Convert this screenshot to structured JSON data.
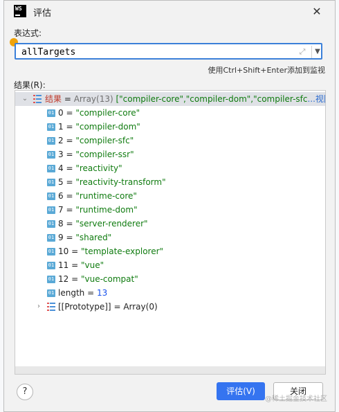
{
  "window": {
    "app_icon_text": "WS",
    "title": "评估"
  },
  "expression": {
    "label": "表达式:",
    "value": "allTargets",
    "hint": "使用Ctrl+Shift+Enter添加到监视"
  },
  "result": {
    "label": "结果(R):",
    "root": {
      "name": "结果",
      "eq": " = ",
      "type": "Array(13)",
      "preview": " [\"compiler-core\",\"compiler-dom\",\"compiler-sfc",
      "link": "...视图"
    },
    "items": [
      {
        "index": "0",
        "value": "\"compiler-core\""
      },
      {
        "index": "1",
        "value": "\"compiler-dom\""
      },
      {
        "index": "2",
        "value": "\"compiler-sfc\""
      },
      {
        "index": "3",
        "value": "\"compiler-ssr\""
      },
      {
        "index": "4",
        "value": "\"reactivity\""
      },
      {
        "index": "5",
        "value": "\"reactivity-transform\""
      },
      {
        "index": "6",
        "value": "\"runtime-core\""
      },
      {
        "index": "7",
        "value": "\"runtime-dom\""
      },
      {
        "index": "8",
        "value": "\"server-renderer\""
      },
      {
        "index": "9",
        "value": "\"shared\""
      },
      {
        "index": "10",
        "value": "\"template-explorer\""
      },
      {
        "index": "11",
        "value": "\"vue\""
      },
      {
        "index": "12",
        "value": "\"vue-compat\""
      }
    ],
    "length": {
      "name": "length",
      "value": "13"
    },
    "prototype": {
      "name": "[[Prototype]]",
      "value": "Array(0)"
    }
  },
  "buttons": {
    "help": "?",
    "evaluate": "评估(V)",
    "close": "关闭"
  },
  "watermark": "@稀土掘金技术社区",
  "colors": {
    "primary": "#3574f0",
    "string": "#0f7b0f",
    "number": "#1750eb",
    "focus": "#3b80d9"
  }
}
